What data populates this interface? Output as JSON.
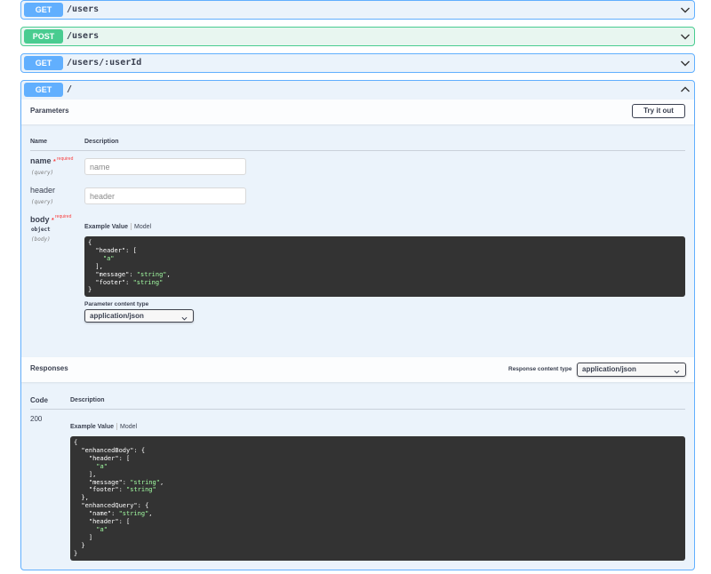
{
  "operations": [
    {
      "method": "GET",
      "path": "/users"
    },
    {
      "method": "POST",
      "path": "/users"
    },
    {
      "method": "GET",
      "path": "/users/:userId"
    },
    {
      "method": "GET",
      "path": "/"
    }
  ],
  "colors": {
    "get": "#61affe",
    "post": "#49cc90",
    "required": "#f93e3e",
    "code_bg": "#333333"
  },
  "icons": {
    "collapsed": "chevron-down-icon",
    "expanded": "chevron-up-icon",
    "select": "chevron-down-icon"
  },
  "parameters": {
    "title": "Parameters",
    "try_label": "Try it out",
    "col_name": "Name",
    "col_description": "Description",
    "required_label": "required",
    "items": [
      {
        "name": "name",
        "in": "(query)",
        "required": true,
        "placeholder": "name"
      },
      {
        "name": "header",
        "in": "(query)",
        "required": false,
        "placeholder": "header"
      },
      {
        "name": "body",
        "type": "object",
        "in": "(body)",
        "required": true
      }
    ],
    "example_value_label": "Example Value",
    "model_label": "Model",
    "content_type_label": "Parameter content type",
    "content_type_value": "application/json"
  },
  "responses": {
    "title": "Responses",
    "content_type_label": "Response content type",
    "content_type_value": "application/json",
    "col_code": "Code",
    "col_description": "Description",
    "code": "200",
    "example_value_label": "Example Value",
    "model_label": "Model"
  }
}
